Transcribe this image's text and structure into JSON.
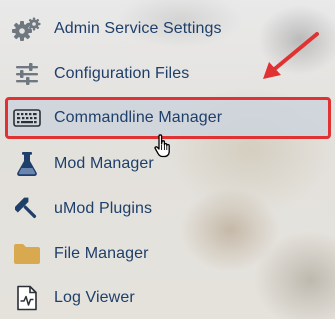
{
  "menu": {
    "items": [
      {
        "label": "Admin Service Settings",
        "icon": "gears-icon"
      },
      {
        "label": "Configuration Files",
        "icon": "sliders-icon"
      },
      {
        "label": "Commandline Manager",
        "icon": "keyboard-icon"
      },
      {
        "label": "Mod Manager",
        "icon": "flask-icon"
      },
      {
        "label": "uMod Plugins",
        "icon": "hammer-icon"
      },
      {
        "label": "File Manager",
        "icon": "folder-icon"
      },
      {
        "label": "Log Viewer",
        "icon": "log-file-icon"
      }
    ],
    "highlighted_item": "Commandline Manager"
  },
  "colors": {
    "label_text": "#1f3f6b",
    "highlight_border": "#e03232",
    "arrow": "#e03232",
    "icon_gray": "#6f7780",
    "icon_navy": "#1f3f6b",
    "folder": "#d9a94f"
  }
}
